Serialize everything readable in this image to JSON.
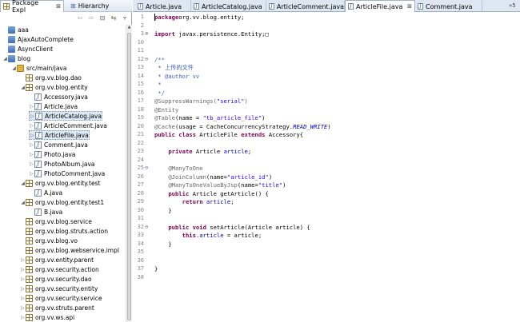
{
  "explorer": {
    "tabs": [
      {
        "label": "Package Expl",
        "close": "⊠"
      },
      {
        "label": "Hierarchy",
        "close": ""
      }
    ],
    "toolbar": {
      "back": "⇦",
      "forward": "⇨",
      "collapse": "⊟",
      "link": "⇆",
      "menu": "▿"
    },
    "tree": [
      {
        "label": "aaa",
        "type": "project",
        "depth": 0,
        "arrow": ""
      },
      {
        "label": "AjaxAutoComplete",
        "type": "project",
        "depth": 0,
        "arrow": ""
      },
      {
        "label": "AsyncClient",
        "type": "project",
        "depth": 0,
        "arrow": ""
      },
      {
        "label": "blog",
        "type": "project",
        "depth": 0,
        "arrow": "◢"
      },
      {
        "label": "src/main/java",
        "type": "src",
        "depth": 1,
        "arrow": "◢"
      },
      {
        "label": "org.vv.blog.dao",
        "type": "package",
        "depth": 2,
        "arrow": ""
      },
      {
        "label": "org.vv.blog.entity",
        "type": "package",
        "depth": 2,
        "arrow": "◢"
      },
      {
        "label": "Accessory.java",
        "type": "java",
        "depth": 3,
        "arrow": ""
      },
      {
        "label": "Article.java",
        "type": "java",
        "depth": 3,
        "arrow": "▷"
      },
      {
        "label": "ArticleCatalog.java",
        "type": "java",
        "depth": 3,
        "arrow": "▷",
        "selected": true
      },
      {
        "label": "ArticleComment.java",
        "type": "java",
        "depth": 3,
        "arrow": "▷"
      },
      {
        "label": "ArticleFile.java",
        "type": "java",
        "depth": 3,
        "arrow": "▷",
        "selected": true
      },
      {
        "label": "Comment.java",
        "type": "java",
        "depth": 3,
        "arrow": "▷"
      },
      {
        "label": "Photo.java",
        "type": "java",
        "depth": 3,
        "arrow": "▷"
      },
      {
        "label": "PhotoAlbum.java",
        "type": "java",
        "depth": 3,
        "arrow": "▷"
      },
      {
        "label": "PhotoComment.java",
        "type": "java",
        "depth": 3,
        "arrow": "▷"
      },
      {
        "label": "org.vv.blog.entity.test",
        "type": "package",
        "depth": 2,
        "arrow": "◢"
      },
      {
        "label": "A.java",
        "type": "java",
        "depth": 3,
        "arrow": ""
      },
      {
        "label": "org.vv.blog.entity.test1",
        "type": "package",
        "depth": 2,
        "arrow": "◢"
      },
      {
        "label": "B.java",
        "type": "java",
        "depth": 3,
        "arrow": ""
      },
      {
        "label": "org.vv.blog.service",
        "type": "package",
        "depth": 2,
        "arrow": ""
      },
      {
        "label": "org.vv.blog.struts.action",
        "type": "package",
        "depth": 2,
        "arrow": ""
      },
      {
        "label": "org.vv.blog.vo",
        "type": "package",
        "depth": 2,
        "arrow": ""
      },
      {
        "label": "org.vv.blog.webservice.impl",
        "type": "package",
        "depth": 2,
        "arrow": ""
      },
      {
        "label": "org.vv.entity.parent",
        "type": "package",
        "depth": 2,
        "arrow": "▷"
      },
      {
        "label": "org.vv.security.action",
        "type": "package",
        "depth": 2,
        "arrow": "▷"
      },
      {
        "label": "org.vv.security.dao",
        "type": "package",
        "depth": 2,
        "arrow": "▷"
      },
      {
        "label": "org.vv.security.entity",
        "type": "package",
        "depth": 2,
        "arrow": "▷"
      },
      {
        "label": "org.vv.security.service",
        "type": "package",
        "depth": 2,
        "arrow": "▷"
      },
      {
        "label": "org.vv.struts.parent",
        "type": "package",
        "depth": 2,
        "arrow": "▷"
      },
      {
        "label": "org.vv.ws.api",
        "type": "package",
        "depth": 2,
        "arrow": "▷"
      }
    ]
  },
  "editor": {
    "tabs": [
      {
        "label": "Article.java",
        "active": false,
        "close": ""
      },
      {
        "label": "ArticleCatalog.java",
        "active": false,
        "close": ""
      },
      {
        "label": "ArticleComment.java",
        "active": false,
        "close": ""
      },
      {
        "label": "ArticleFile.java",
        "active": true,
        "close": "⊠"
      },
      {
        "label": "Comment.java",
        "active": false,
        "close": ""
      }
    ],
    "overflow": "»5",
    "code_lines": [
      {
        "n": "1",
        "fold": "",
        "segs": [
          [
            "kw",
            "package"
          ],
          [
            "",
            "org.vv.blog.entity;"
          ]
        ]
      },
      {
        "n": "2",
        "fold": "",
        "segs": []
      },
      {
        "n": "3",
        "fold": "⊕",
        "segs": [
          [
            "kw",
            "import"
          ],
          [
            "",
            " javax.persistence.Entity;"
          ],
          [
            "",
            "□"
          ]
        ]
      },
      {
        "n": "10",
        "fold": "",
        "segs": []
      },
      {
        "n": "11",
        "fold": "",
        "segs": []
      },
      {
        "n": "12",
        "fold": "⊖",
        "segs": [
          [
            "cm",
            "/**"
          ]
        ]
      },
      {
        "n": "13",
        "fold": "",
        "segs": [
          [
            "cm",
            " * 上传的文件"
          ]
        ]
      },
      {
        "n": "14",
        "fold": "",
        "segs": [
          [
            "cm",
            " * @author vv"
          ]
        ]
      },
      {
        "n": "15",
        "fold": "",
        "segs": [
          [
            "cm",
            " *"
          ]
        ]
      },
      {
        "n": "16",
        "fold": "",
        "segs": [
          [
            "cm",
            " */"
          ]
        ]
      },
      {
        "n": "17",
        "fold": "",
        "segs": [
          [
            "an",
            "@SuppressWarnings("
          ],
          [
            "st",
            "\"serial\""
          ],
          [
            "an",
            ")"
          ]
        ]
      },
      {
        "n": "18",
        "fold": "",
        "segs": [
          [
            "an",
            "@Entity"
          ]
        ]
      },
      {
        "n": "19",
        "fold": "",
        "segs": [
          [
            "an",
            "@Table"
          ],
          [
            "",
            "(name = "
          ],
          [
            "st",
            "\"tb_article_file\""
          ],
          [
            "",
            ")"
          ]
        ]
      },
      {
        "n": "20",
        "fold": "",
        "segs": [
          [
            "an",
            "@Cache"
          ],
          [
            "",
            "(usage = CacheConcurrencyStrategy."
          ],
          [
            "it",
            "READ_WRITE"
          ],
          [
            "",
            ")"
          ]
        ]
      },
      {
        "n": "21",
        "fold": "",
        "segs": [
          [
            "kw",
            "public class"
          ],
          [
            "",
            " ArticleFile "
          ],
          [
            "kw",
            "extends"
          ],
          [
            "",
            " Accessory{"
          ]
        ]
      },
      {
        "n": "22",
        "fold": "",
        "segs": []
      },
      {
        "n": "23",
        "fold": "",
        "segs": [
          [
            "",
            "    "
          ],
          [
            "kw",
            "private"
          ],
          [
            "",
            " Article "
          ],
          [
            "fd",
            "article"
          ],
          [
            "",
            ";"
          ]
        ]
      },
      {
        "n": "24",
        "fold": "",
        "segs": []
      },
      {
        "n": "25",
        "fold": "⊖",
        "segs": [
          [
            "",
            "    "
          ],
          [
            "an",
            "@ManyToOne"
          ]
        ]
      },
      {
        "n": "26",
        "fold": "",
        "segs": [
          [
            "",
            "    "
          ],
          [
            "an",
            "@JoinColumn"
          ],
          [
            "",
            "(name="
          ],
          [
            "st",
            "\"article_id\""
          ],
          [
            "",
            ")"
          ]
        ]
      },
      {
        "n": "27",
        "fold": "",
        "segs": [
          [
            "",
            "    "
          ],
          [
            "an",
            "@ManyToOneValueByJsp"
          ],
          [
            "",
            "(name="
          ],
          [
            "st",
            "\"title\""
          ],
          [
            "",
            ")"
          ]
        ]
      },
      {
        "n": "28",
        "fold": "",
        "segs": [
          [
            "",
            "    "
          ],
          [
            "kw",
            "public"
          ],
          [
            "",
            " Article getArticle() {"
          ]
        ]
      },
      {
        "n": "29",
        "fold": "",
        "segs": [
          [
            "",
            "        "
          ],
          [
            "kw",
            "return"
          ],
          [
            "",
            " "
          ],
          [
            "fd",
            "article"
          ],
          [
            "",
            ";"
          ]
        ]
      },
      {
        "n": "30",
        "fold": "",
        "segs": [
          [
            "",
            "    }"
          ]
        ]
      },
      {
        "n": "31",
        "fold": "",
        "segs": []
      },
      {
        "n": "32",
        "fold": "⊖",
        "segs": [
          [
            "",
            "    "
          ],
          [
            "kw",
            "public void"
          ],
          [
            "",
            " setArticle(Article article) {"
          ]
        ]
      },
      {
        "n": "33",
        "fold": "",
        "segs": [
          [
            "",
            "        "
          ],
          [
            "kw",
            "this"
          ],
          [
            "",
            "."
          ],
          [
            "fd",
            "article"
          ],
          [
            "",
            " = article;"
          ]
        ]
      },
      {
        "n": "34",
        "fold": "",
        "segs": [
          [
            "",
            "    }"
          ]
        ]
      },
      {
        "n": "35",
        "fold": "",
        "segs": []
      },
      {
        "n": "36",
        "fold": "",
        "segs": []
      },
      {
        "n": "37",
        "fold": "",
        "segs": [
          [
            "",
            "}"
          ]
        ]
      },
      {
        "n": "38",
        "fold": "",
        "segs": []
      }
    ]
  }
}
